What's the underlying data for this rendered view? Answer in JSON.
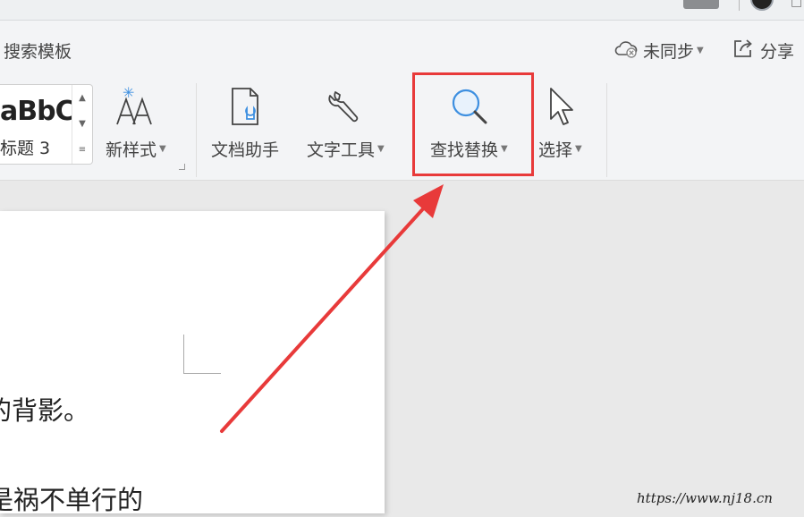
{
  "ribbon": {
    "tab_label": "搜索模板",
    "sync_label": "未同步",
    "share_label": "分享",
    "style_sample": "aBbCc",
    "style_name": "标题 3",
    "tools": [
      {
        "label": "新样式",
        "icon": "new-style-icon"
      },
      {
        "label": "文档助手",
        "icon": "document-assistant-icon"
      },
      {
        "label": "文字工具",
        "icon": "text-tool-wrench-icon"
      },
      {
        "label": "查找替换",
        "icon": "magnifier-icon"
      },
      {
        "label": "选择",
        "icon": "cursor-arrow-icon"
      }
    ]
  },
  "document": {
    "lines": [
      "的背影。",
      "是祸不单行的"
    ]
  },
  "annotation": {
    "highlight_color": "#e83a3a",
    "arrow_color": "#e83a3a"
  },
  "watermark": "https://www.nj18.cn"
}
